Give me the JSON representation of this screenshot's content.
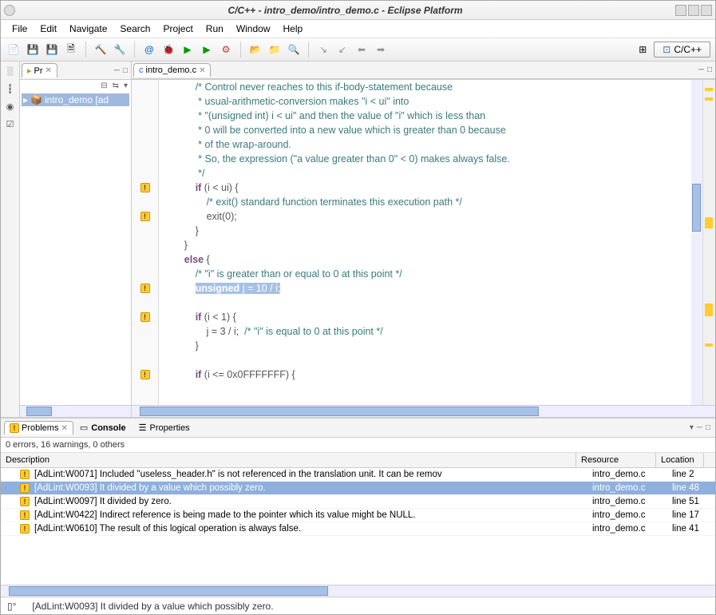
{
  "title": "C/C++ - intro_demo/intro_demo.c - Eclipse Platform",
  "menu": {
    "file": "File",
    "edit": "Edit",
    "navigate": "Navigate",
    "search": "Search",
    "project": "Project",
    "run": "Run",
    "window": "Window",
    "help": "Help"
  },
  "perspective": {
    "label": "C/C++"
  },
  "project_explorer": {
    "tab_label": "Pr",
    "tree_item": "intro_demo [ad"
  },
  "editor": {
    "tab_label": "intro_demo.c",
    "lines": [
      {
        "html": "            <span class='cm'>/* Control never reaches to this if-body-statement because</span>"
      },
      {
        "html": "            <span class='cm'> * usual-arithmetic-conversion makes \"i &lt; ui\" into</span>"
      },
      {
        "html": "            <span class='cm'> * \"(unsigned int) i &lt; ui\" and then the value of \"i\" which is less than</span>"
      },
      {
        "html": "            <span class='cm'> * 0 will be converted into a new value which is greater than 0 because</span>"
      },
      {
        "html": "            <span class='cm'> * of the wrap-around.</span>"
      },
      {
        "html": "            <span class='cm'> * So, the expression (\"a value greater than 0\" &lt; 0) makes always false.</span>"
      },
      {
        "html": "            <span class='cm'> */</span>"
      },
      {
        "marker": "warn",
        "html": "            <span class='kw'>if</span> (i &lt; ui) {"
      },
      {
        "html": "                <span class='cm'>/* exit() standard function terminates this execution path */</span>"
      },
      {
        "marker": "warn",
        "html": "                exit(0);"
      },
      {
        "html": "            }"
      },
      {
        "html": "        }"
      },
      {
        "html": "        <span class='kw'>else</span> {"
      },
      {
        "html": "            <span class='cm'>/* \"i\" is greater than or equal to 0 at this point */</span>"
      },
      {
        "marker": "warn",
        "highlight": true,
        "html": "            <span class='hl'><span class='kw'>unsigned</span> j = 10 / i;</span>"
      },
      {
        "html": ""
      },
      {
        "marker": "warn",
        "html": "            <span class='kw'>if</span> (i &lt; 1) {"
      },
      {
        "html": "                j = 3 / i;  <span class='cm'>/* \"i\" is equal to 0 at this point */</span>"
      },
      {
        "html": "            }"
      },
      {
        "html": ""
      },
      {
        "marker": "warn",
        "html": "            <span class='kw'>if</span> (i &lt;= 0x0FFFFFFF) {"
      }
    ]
  },
  "problems": {
    "tab_problems": "Problems",
    "tab_console": "Console",
    "tab_properties": "Properties",
    "summary": "0 errors, 16 warnings, 0 others",
    "columns": {
      "desc": "Description",
      "res": "Resource",
      "loc": "Location"
    },
    "rows": [
      {
        "desc": "[AdLint:W0071] Included \"useless_header.h\" is not referenced in the translation unit. It can be remov",
        "res": "intro_demo.c",
        "loc": "line 2"
      },
      {
        "desc": "[AdLint:W0093] It divided by a value which possibly zero.",
        "res": "intro_demo.c",
        "loc": "line 48",
        "selected": true
      },
      {
        "desc": "[AdLint:W0097] It divided by zero.",
        "res": "intro_demo.c",
        "loc": "line 51"
      },
      {
        "desc": "[AdLint:W0422] Indirect reference is being made to the pointer which its value might be NULL.",
        "res": "intro_demo.c",
        "loc": "line 17"
      },
      {
        "desc": "[AdLint:W0610] The result of this logical operation is always false.",
        "res": "intro_demo.c",
        "loc": "line 41"
      }
    ]
  },
  "status": {
    "msg": "[AdLint:W0093] It divided by a value which possibly zero."
  }
}
